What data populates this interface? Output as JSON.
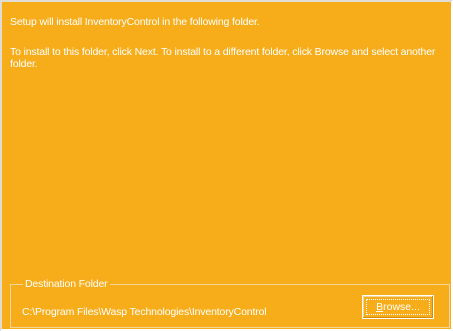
{
  "intro": {
    "line1": "Setup will install InventoryControl in the following folder.",
    "line2": "To install to this folder, click Next. To install to a different folder, click Browse and select another folder."
  },
  "destination": {
    "legend": "Destination Folder",
    "path": "C:\\Program Files\\Wasp Technologies\\InventoryControl",
    "browse_mnemonic": "B",
    "browse_rest": "rowse..."
  },
  "colors": {
    "background": "#f7ad1a",
    "text": "#ffffff"
  }
}
